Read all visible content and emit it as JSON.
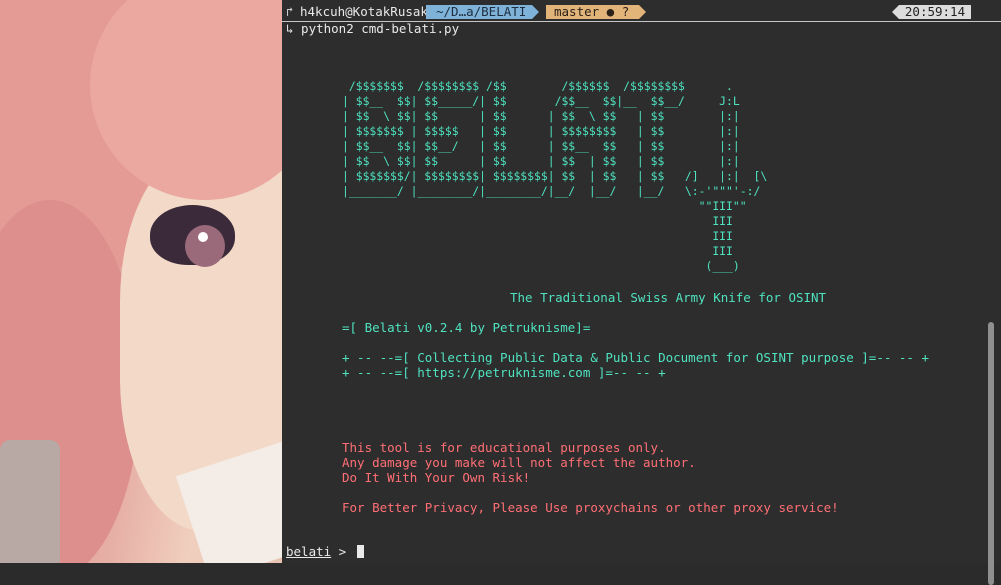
{
  "prompt": {
    "symbol": "↱",
    "user_host": "h4kcuh@KotakRusak",
    "path": "~/D…a/BELATI",
    "git_branch": "master ● ?",
    "time": "20:59:14",
    "command": "↳ python2 cmd-belati.py"
  },
  "banner": {
    "ascii_art": " /$$$$$$$  /$$$$$$$$ /$$        /$$$$$$  /$$$$$$$$      .\n| $$__  $$| $$_____/| $$       /$$__  $$|__  $$__/     J:L\n| $$  \\ $$| $$      | $$      | $$  \\ $$   | $$        |:|\n| $$$$$$$ | $$$$$   | $$      | $$$$$$$$   | $$        |:|\n| $$__  $$| $$__/   | $$      | $$__  $$   | $$        |:|\n| $$  \\ $$| $$      | $$      | $$  | $$   | $$        |:|\n| $$$$$$$/| $$$$$$$$| $$$$$$$$| $$  | $$   | $$   /]   |:|  [\\\n|_______/ |________/|________/|__/  |__/   |__/   \\:-'\"\"\"'-:/\n                                                    \"\"III\"\"\n                                                      III\n                                                      III\n                                                      III\n                                                     (___)",
    "tagline": "The Traditional Swiss Army Knife for OSINT",
    "version": "=[ Belati v0.2.4 by Petruknisme]=",
    "info1": "+ -- --=[ Collecting Public Data & Public Document for OSINT purpose ]=-- -- +",
    "info2": "+ -- --=[ https://petruknisme.com ]=-- -- +"
  },
  "disclaimer": {
    "line1": "This tool is for educational purposes only.",
    "line2": "Any damage you make will not affect the author.",
    "line3": "Do It With Your Own Risk!",
    "line4": "For Better Privacy, Please Use proxychains or other proxy service!"
  },
  "shell": {
    "name": "belati",
    "arrow": " > "
  },
  "colors": {
    "accent_green": "#4fe3c0",
    "warning_red": "#ff6f75",
    "dir_segment": "#7fb2d9",
    "git_segment": "#e3b47a"
  }
}
